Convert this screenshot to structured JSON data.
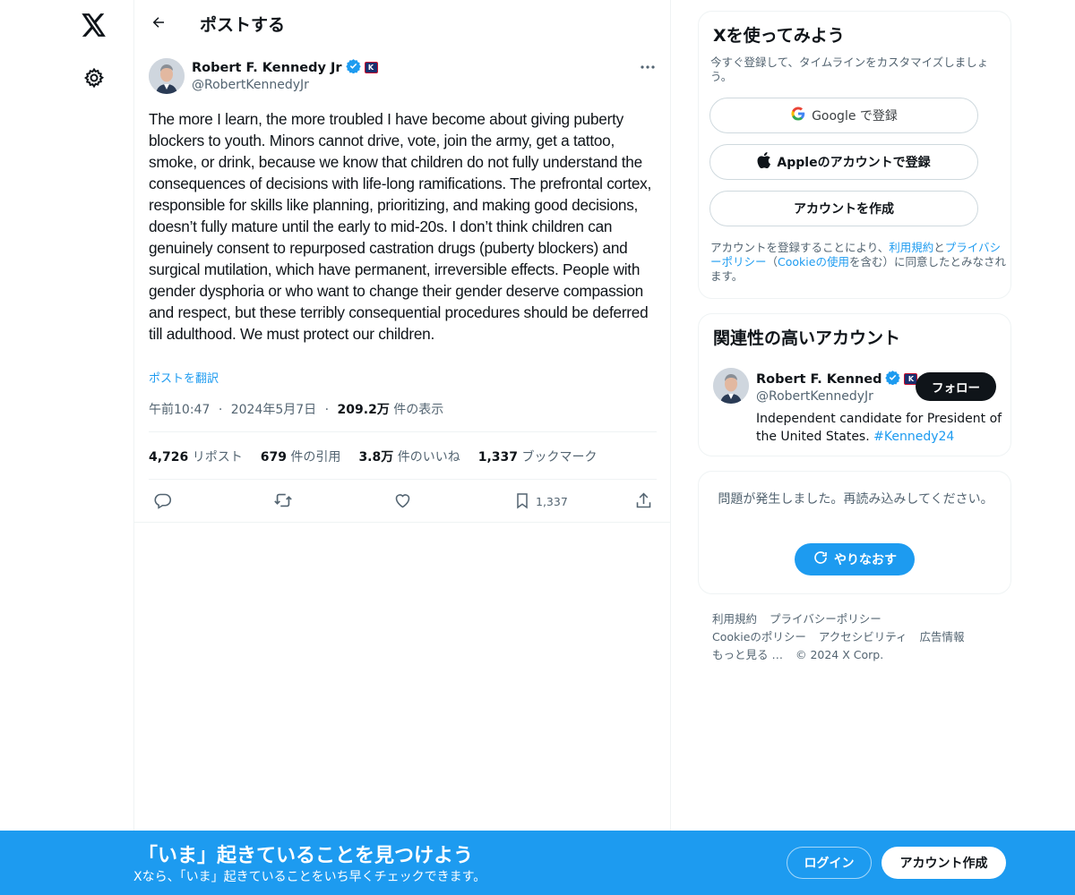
{
  "colors": {
    "accent": "#1d9bf0",
    "text": "#0f1419",
    "muted": "#536471",
    "border": "#eff3f4"
  },
  "nav": {
    "logo_icon": "x-logo-icon",
    "settings_icon": "gear-icon"
  },
  "header": {
    "title": "ポストする",
    "back_icon": "arrow-left-icon"
  },
  "tweet": {
    "author_name": "Robert F. Kennedy Jr",
    "author_handle": "@RobertKennedyJr",
    "badge_letter": "K",
    "text": "The more I learn, the more troubled I have become about giving puberty blockers to youth. Minors cannot drive, vote, join the army, get a tattoo, smoke, or drink, because we know that children do not fully understand the consequences of decisions with life-long ramifications. The prefrontal cortex, responsible for skills like planning, prioritizing, and making good decisions, doesn’t fully mature until the early to mid-20s. I don’t think children can genuinely consent to repurposed castration drugs (puberty blockers) and surgical mutilation, which have permanent, irreversible effects. People with gender dysphoria or who want to change their gender deserve compassion and respect, but these terribly consequential procedures should be deferred till adulthood. We must protect our children.",
    "translate": "ポストを翻訳",
    "time": "午前10:47",
    "sep": "·",
    "date": "2024年5月7日",
    "views_count": "209.2万",
    "views_label": " 件の表示",
    "stats": {
      "reposts_count": "4,726",
      "reposts_label": " リポスト",
      "quotes_count": "679",
      "quotes_label": " 件の引用",
      "likes_count": "3.8万",
      "likes_label": " 件のいいね",
      "bookmarks_count": "1,337",
      "bookmarks_label": " ブックマーク"
    },
    "bookmark_action_count": "1,337"
  },
  "signup": {
    "title": "Xを使ってみよう",
    "subtitle": "今すぐ登録して、タイムラインをカスタマイズしましょう。",
    "google_label": "Google で登録",
    "apple_label": "Appleのアカウントで登録",
    "create_label": "アカウントを作成",
    "terms_prefix": "アカウントを登録することにより、",
    "terms_link": "利用規約",
    "terms_and": "と",
    "privacy_link": "プライバシーポリシー",
    "terms_open": "（",
    "cookie_link": "Cookieの使用",
    "terms_suffix": "を含む）に同意したとみなされます。"
  },
  "related": {
    "title": "関連性の高いアカウント",
    "name": "Robert F. Kenned",
    "handle": "@RobertKennedyJr",
    "follow_label": "フォロー",
    "bio": "Independent candidate for President of the United States. ",
    "bio_tag": "#Kennedy24"
  },
  "error": {
    "text": "問題が発生しました。再読み込みしてください。",
    "retry_label": "やりなおす"
  },
  "footer": {
    "links": [
      "利用規約",
      "プライバシーポリシー",
      "Cookieのポリシー",
      "アクセシビリティ",
      "広告情報",
      "もっと見る …",
      "© 2024 X Corp."
    ]
  },
  "bottom_bar": {
    "title": "「いま」起きていることを見つけよう",
    "subtitle": "Xなら、「いま」起きていることをいち早くチェックできます。",
    "login_label": "ログイン",
    "create_label": "アカウント作成"
  }
}
